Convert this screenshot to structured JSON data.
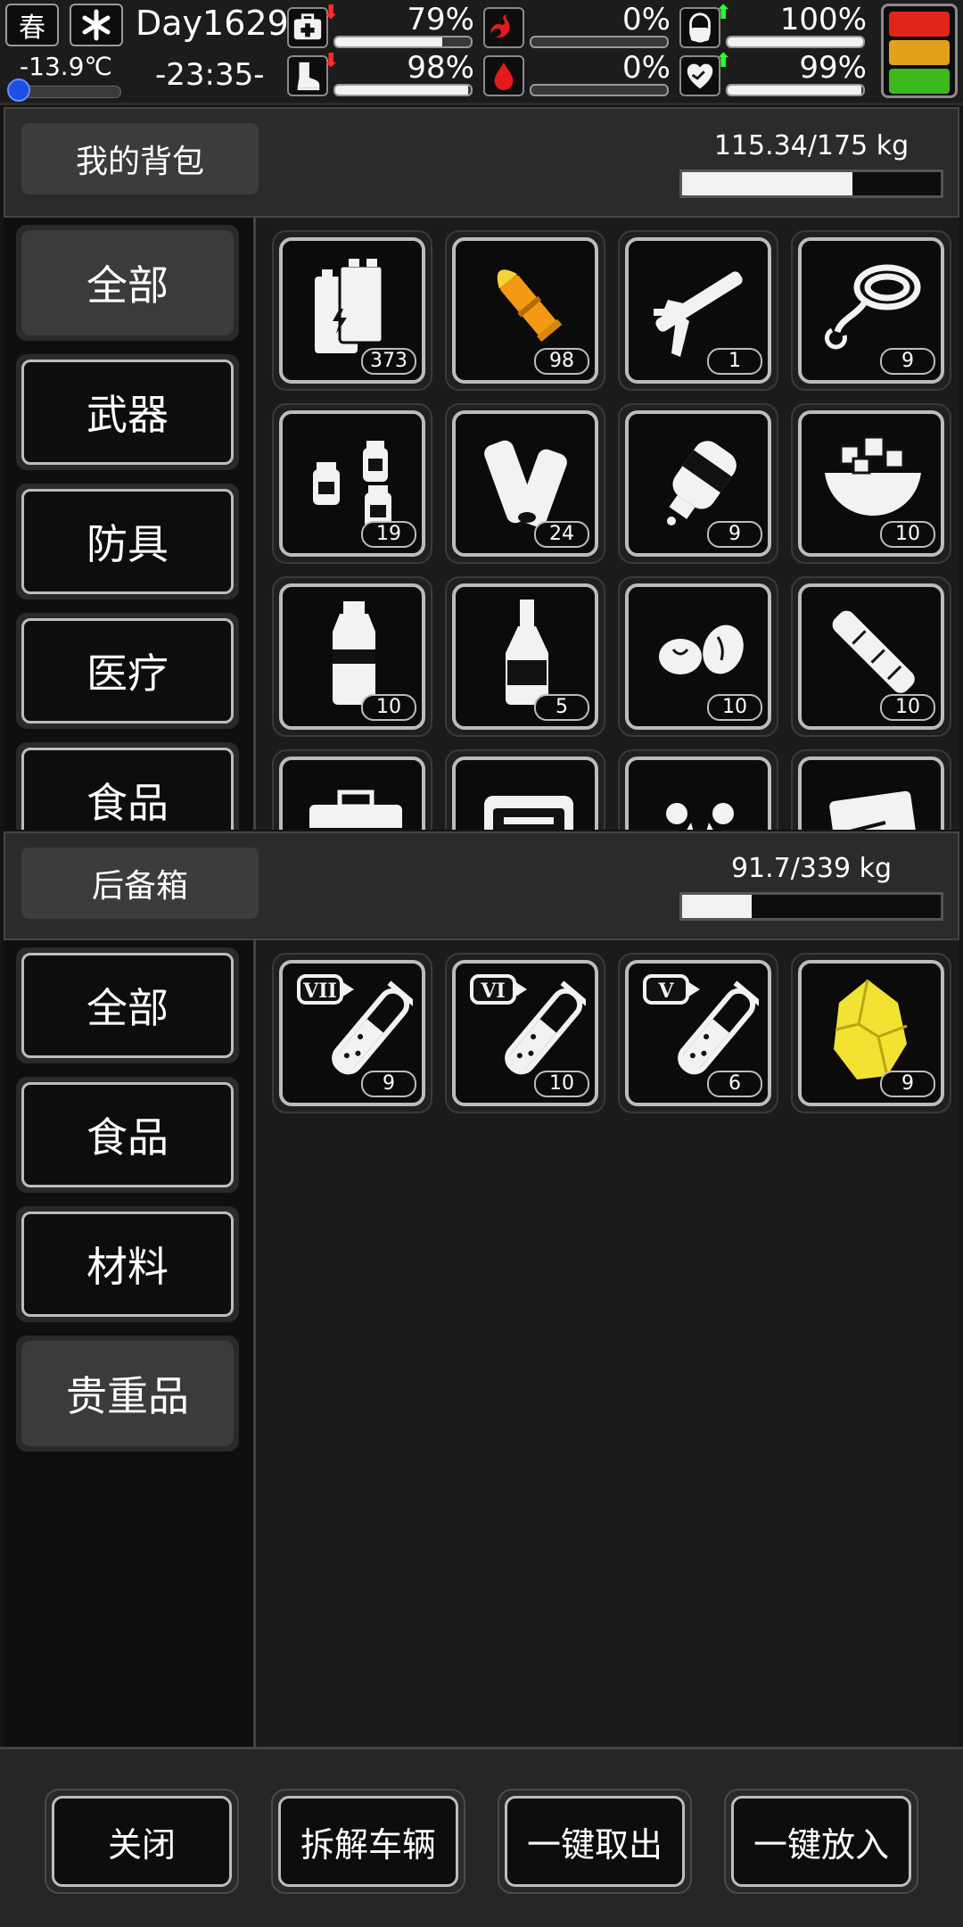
{
  "status": {
    "season": "春",
    "temperature": "-13.9℃",
    "day": "Day1629",
    "time": "-23:35-",
    "stats": [
      {
        "name": "health",
        "percent_text": "79%",
        "value": 0.79,
        "trend": "down",
        "icon": "medkit-icon"
      },
      {
        "name": "hunger",
        "percent_text": "0%",
        "value": 0.0,
        "trend": "",
        "icon": "stomach-icon"
      },
      {
        "name": "mood",
        "percent_text": "100%",
        "value": 1.0,
        "trend": "up",
        "icon": "pill-icon"
      },
      {
        "name": "stamina",
        "percent_text": "98%",
        "value": 0.98,
        "trend": "down",
        "icon": "foot-icon"
      },
      {
        "name": "thirst",
        "percent_text": "0%",
        "value": 0.0,
        "trend": "",
        "icon": "water-drop-icon"
      },
      {
        "name": "heart",
        "percent_text": "99%",
        "value": 0.99,
        "trend": "up",
        "icon": "heart-icon"
      }
    ],
    "traffic_colors": [
      "#e0261b",
      "#e1a21a",
      "#3cb91c"
    ]
  },
  "backpack": {
    "title": "我的背包",
    "weight": "115.34/175 kg",
    "weight_ratio": 0.659,
    "categories": [
      "全部",
      "武器",
      "防具",
      "医疗",
      "食品"
    ],
    "active_category": 0,
    "items": [
      {
        "icon": "battery-icon",
        "qty": "373"
      },
      {
        "icon": "bullet-icon",
        "qty": "98"
      },
      {
        "icon": "caulk-gun-icon",
        "qty": "1"
      },
      {
        "icon": "rope-icon",
        "qty": "9"
      },
      {
        "icon": "jars-icon",
        "qty": "19"
      },
      {
        "icon": "paper-rolls-icon",
        "qty": "24"
      },
      {
        "icon": "glue-bottle-icon",
        "qty": "9"
      },
      {
        "icon": "food-bowl-icon",
        "qty": "10"
      },
      {
        "icon": "water-bottle-icon",
        "qty": "10"
      },
      {
        "icon": "liquor-bottle-icon",
        "qty": "5"
      },
      {
        "icon": "nuts-icon",
        "qty": "10"
      },
      {
        "icon": "stick-icon",
        "qty": "10"
      },
      {
        "icon": "toolbox-icon",
        "qty": ""
      },
      {
        "icon": "tool-kit-icon",
        "qty": ""
      },
      {
        "icon": "herb-icon",
        "qty": ""
      },
      {
        "icon": "blueprint-icon",
        "qty": ""
      }
    ]
  },
  "trunk": {
    "title": "后备箱",
    "weight": "91.7/339 kg",
    "weight_ratio": 0.27,
    "categories": [
      "全部",
      "食品",
      "材料",
      "贵重品"
    ],
    "active_category": 3,
    "items": [
      {
        "icon": "test-tube-icon",
        "tier": "VII",
        "qty": "9"
      },
      {
        "icon": "test-tube-icon",
        "tier": "VI",
        "qty": "10"
      },
      {
        "icon": "test-tube-icon",
        "tier": "V",
        "qty": "6"
      },
      {
        "icon": "gold-ore-icon",
        "tier": "",
        "qty": "9"
      }
    ]
  },
  "actions": [
    "关闭",
    "拆解车辆",
    "一键取出",
    "一键放入"
  ]
}
